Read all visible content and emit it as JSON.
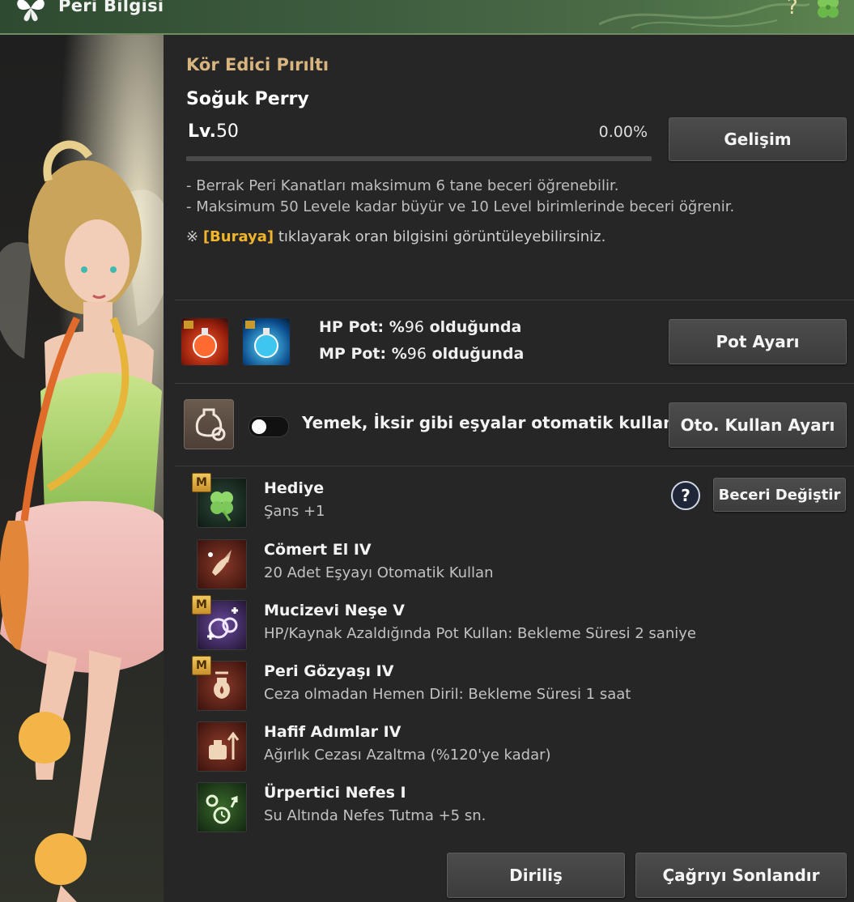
{
  "header": {
    "title": "Peri Bilgisi",
    "help_symbol": "?"
  },
  "fairy": {
    "effect_name": "Kör Edici Pırıltı",
    "name": "Soğuk Perry",
    "level_prefix": "Lv.",
    "level_value": "50",
    "progress_text": "0.00%",
    "progress_fraction": 0.0
  },
  "buttons": {
    "growth": "Gelişim",
    "pot_settings": "Pot Ayarı",
    "auto_use_settings": "Oto. Kullan Ayarı",
    "change_skill": "Beceri Değiştir",
    "revive": "Diriliş",
    "end_summon": "Çağrıyı Sonlandır"
  },
  "info": {
    "line1_a": "- Berrak Peri Kanatları maksimum ",
    "line1_num": "6",
    "line1_b": " tane beceri öğrenebilir.",
    "line2_a": "- Maksimum ",
    "line2_num1": "50",
    "line2_b": " Levele kadar büyür ve ",
    "line2_num2": "10",
    "line2_c": " Level birimlerinde beceri öğrenir.",
    "note_prefix": "※ ",
    "note_link": "[Buraya]",
    "note_suffix": " tıklayarak oran bilgisini görüntüleyebilirsiniz."
  },
  "pots": {
    "hp_label": "HP Pot: %",
    "hp_value": "96",
    "hp_suffix": " olduğunda",
    "mp_label": "MP Pot: %",
    "mp_value": "96",
    "mp_suffix": " olduğunda"
  },
  "auto_use": {
    "label": "Yemek, İksir gibi eşyalar otomatik kullanılır.",
    "enabled": false
  },
  "skills": [
    {
      "name": "Hediye",
      "desc": "Şans +1",
      "badge": "M",
      "icon": "clover-icon"
    },
    {
      "name": "Cömert El IV",
      "desc": "20 Adet Eşyayı Otomatik Kullan",
      "badge": "",
      "icon": "fairy-hand-icon"
    },
    {
      "name": "Mucizevi Neşe V",
      "desc": "HP/Kaynak Azaldığında Pot Kullan: Bekleme Süresi 2 saniye",
      "badge": "M",
      "icon": "potion-plus-icon"
    },
    {
      "name": "Peri Gözyaşı IV",
      "desc": "Ceza olmadan Hemen Diril: Bekleme Süresi 1 saat",
      "badge": "M",
      "icon": "tear-bottle-icon"
    },
    {
      "name": "Hafif Adımlar IV",
      "desc": "Ağırlık Cezası Azaltma (%120'ye kadar)",
      "badge": "",
      "icon": "weight-arrow-icon"
    },
    {
      "name": "Ürpertici Nefes I",
      "desc": "Su Altında Nefes Tutma +5 sn.",
      "badge": "",
      "icon": "bubble-breath-icon"
    }
  ],
  "colors": {
    "accent_gold": "#d8b47e",
    "link_orange": "#f0b52c",
    "header_green": "#3f5e40"
  }
}
